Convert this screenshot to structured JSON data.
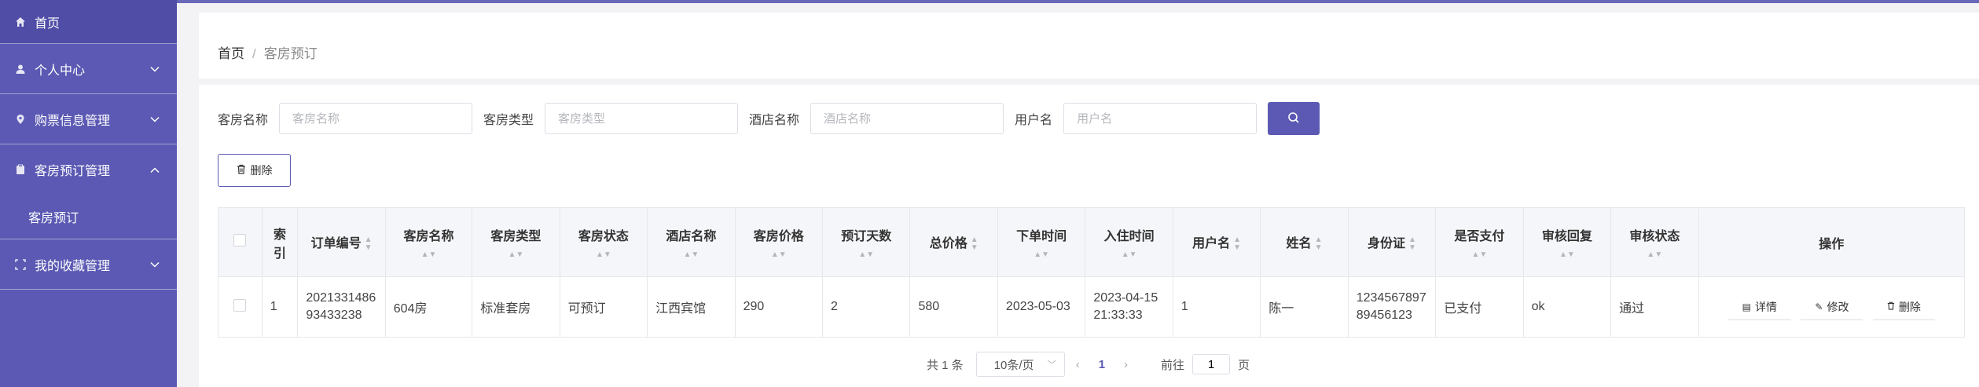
{
  "sidebar": {
    "items": [
      {
        "label": "首页",
        "icon": "home-icon"
      },
      {
        "label": "个人中心",
        "icon": "user-icon"
      },
      {
        "label": "购票信息管理",
        "icon": "location-icon"
      },
      {
        "label": "客房预订管理",
        "icon": "clipboard-icon",
        "sub": [
          "客房预订"
        ]
      },
      {
        "label": "我的收藏管理",
        "icon": "frame-icon"
      }
    ]
  },
  "breadcrumb": {
    "home": "首页",
    "separator": "/",
    "current": "客房预订"
  },
  "filters": [
    {
      "label": "客房名称",
      "placeholder": "客房名称"
    },
    {
      "label": "客房类型",
      "placeholder": "客房类型"
    },
    {
      "label": "酒店名称",
      "placeholder": "酒店名称"
    },
    {
      "label": "用户名",
      "placeholder": "用户名"
    }
  ],
  "toolbar": {
    "delete_label": "删除"
  },
  "table": {
    "headers": [
      "索引",
      "订单编号",
      "客房名称",
      "客房类型",
      "客房状态",
      "酒店名称",
      "客房价格",
      "预订天数",
      "总价格",
      "下单时间",
      "入住时间",
      "用户名",
      "姓名",
      "身份证",
      "是否支付",
      "审核回复",
      "审核状态",
      "操作"
    ],
    "rows": [
      {
        "index": "1",
        "order_no": "202133148693433238",
        "room_name": "604房",
        "room_type": "标准套房",
        "room_status": "可预订",
        "hotel": "江西宾馆",
        "price": "290",
        "days": "2",
        "total": "580",
        "order_time": "2023-05-03",
        "checkin_time": "2023-04-15 21:33:33",
        "username": "1",
        "name": "陈一",
        "id_card": "123456789789456123",
        "paid": "已支付",
        "reply": "ok",
        "audit": "通过",
        "actions": [
          "详情",
          "修改",
          "删除"
        ]
      }
    ]
  },
  "pagination": {
    "total": "共 1 条",
    "page_size": "10条/页",
    "current": "1",
    "goto_prefix": "前往",
    "goto_value": "1",
    "goto_suffix": "页"
  },
  "colors": {
    "accent": "#5b59b3"
  }
}
